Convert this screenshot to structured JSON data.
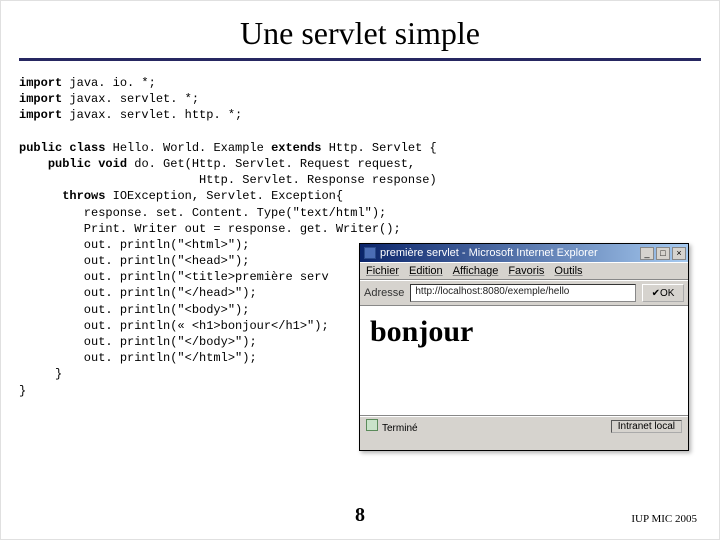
{
  "title": "Une servlet simple",
  "code": {
    "kw_import": "import",
    "imp1": " java. io. *;",
    "imp2": " javax. servlet. *;",
    "imp3": " javax. servlet. http. *;",
    "kw_public": "public",
    "kw_class": "class",
    "cl_decl_rest": " Hello. World. Example ",
    "kw_extends": "extends",
    "cl_decl_rest2": " Http. Servlet {",
    "kw_void": "void",
    "m_decl_rest": " do. Get(Http. Servlet. Request request,",
    "m_decl_line2": "                         Http. Servlet. Response response)",
    "kw_throws": "throws",
    "m_throws_rest": " IOException, Servlet. Exception{",
    "l1": "         response. set. Content. Type(\"text/html\");",
    "l2": "         Print. Writer out = response. get. Writer();",
    "l3": "         out. println(\"<html>\");",
    "l4": "         out. println(\"<head>\");",
    "l5": "         out. println(\"<title>première serv",
    "l6": "         out. println(\"</head>\");",
    "l7": "         out. println(\"<body>\");",
    "l8": "         out. println(« <h1>bonjour</h1>\");",
    "l9": "         out. println(\"</body>\");",
    "l10": "         out. println(\"</html>\");",
    "close1": "     }",
    "close2": "}"
  },
  "browser": {
    "title": "première servlet - Microsoft Internet Explorer",
    "menu": {
      "file": "Fichier",
      "edit": "Edition",
      "view": "Affichage",
      "fav": "Favoris",
      "tools": "Outils"
    },
    "addr_label": "Adresse",
    "url": "http://localhost:8080/exemple/hello",
    "go": "OK",
    "heading": "bonjour",
    "status_left": "Terminé",
    "status_right": "Intranet local"
  },
  "page_number": "8",
  "footer": "IUP MIC 2005"
}
